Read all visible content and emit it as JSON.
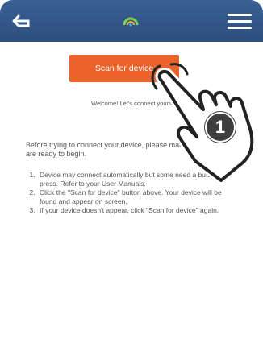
{
  "header": {
    "back_icon": "back-arrow-icon",
    "logo_icon": "app-logo-icon",
    "menu_icon": "hamburger-menu-icon"
  },
  "main": {
    "scan_button_label": "Scan for device",
    "welcome_text": "Welcome! Let's connect yours",
    "intro_text": "Before trying to connect your device, please make sure they are ready to begin.",
    "steps": [
      "Device may connect automatically but some need a button press. Refer to your User Manuals.",
      "Click the \"Scan for device\" button above. Your device will be found and appear on screen.",
      "If your device doesn't appear, click \"Scan for device\" again."
    ]
  },
  "annotation": {
    "step_number": "1",
    "pointer_icon": "hand-pointer-icon"
  },
  "colors": {
    "header_bg": "#345a8c",
    "accent": "#ea5a1f",
    "badge_bg": "#3e3e3e"
  }
}
